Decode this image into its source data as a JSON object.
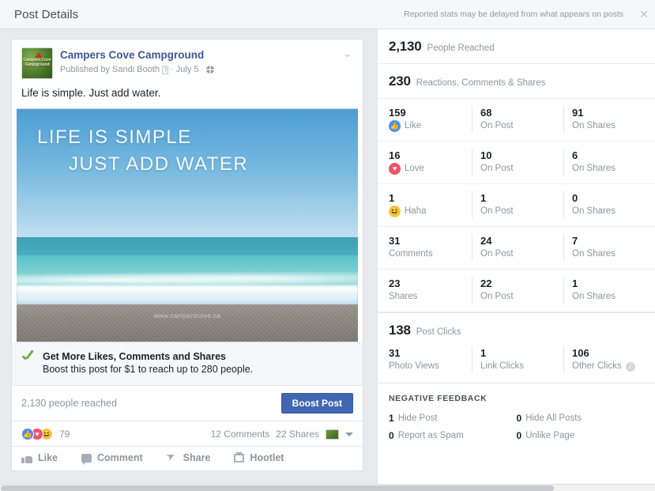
{
  "titlebar": {
    "title": "Post Details",
    "note": "Reported stats may be delayed from what appears on posts",
    "close_icon": "✕"
  },
  "post": {
    "page_name": "Campers Cove Campground",
    "published_prefix": "Published by Sandi Booth",
    "question_mark": "?",
    "separator": "·",
    "date": "July 5",
    "caret": "⌄",
    "message": "Life is simple. Just add water.",
    "photo": {
      "caption_line1": "LIFE IS SIMPLE",
      "caption_line2": "JUST ADD WATER",
      "watermark": "www.camperscove.ca"
    },
    "boost": {
      "title": "Get More Likes, Comments and Shares",
      "subtitle": "Boost this post for $1 to reach up to 280 people.",
      "reach_text": "2,130 people reached",
      "button_label": "Boost Post"
    },
    "engagement": {
      "reaction_count": "79",
      "comments_text": "12 Comments",
      "shares_text": "22 Shares",
      "caret": "▾"
    },
    "actions": [
      {
        "label": "Like",
        "icon": "thumb-icon"
      },
      {
        "label": "Comment",
        "icon": "comment-icon"
      },
      {
        "label": "Share",
        "icon": "share-icon"
      },
      {
        "label": "Hootlet",
        "icon": "hootlet-icon"
      }
    ]
  },
  "stats": {
    "reached": {
      "value": "2,130",
      "label": "People Reached"
    },
    "reactions_summary": {
      "value": "230",
      "label": "Reactions, Comments & Shares"
    },
    "rows": [
      {
        "icon": "like-icon",
        "total": "159",
        "total_label": "Like",
        "on_post": "68",
        "on_post_label": "On Post",
        "on_shares": "91",
        "on_shares_label": "On Shares"
      },
      {
        "icon": "love-icon",
        "total": "16",
        "total_label": "Love",
        "on_post": "10",
        "on_post_label": "On Post",
        "on_shares": "6",
        "on_shares_label": "On Shares"
      },
      {
        "icon": "haha-icon",
        "total": "1",
        "total_label": "Haha",
        "on_post": "1",
        "on_post_label": "On Post",
        "on_shares": "0",
        "on_shares_label": "On Shares"
      },
      {
        "icon": "",
        "total": "31",
        "total_label": "Comments",
        "on_post": "24",
        "on_post_label": "On Post",
        "on_shares": "7",
        "on_shares_label": "On Shares"
      },
      {
        "icon": "",
        "total": "23",
        "total_label": "Shares",
        "on_post": "22",
        "on_post_label": "On Post",
        "on_shares": "1",
        "on_shares_label": "On Shares"
      }
    ],
    "clicks": {
      "value": "138",
      "label": "Post Clicks",
      "photo_views": "31",
      "photo_views_label": "Photo Views",
      "link_clicks": "1",
      "link_clicks_label": "Link Clicks",
      "other_clicks": "106",
      "other_clicks_label": "Other Clicks",
      "info_icon": "i"
    },
    "negative_feedback": {
      "title": "NEGATIVE FEEDBACK",
      "items": [
        {
          "value": "1",
          "label": "Hide Post"
        },
        {
          "value": "0",
          "label": "Hide All Posts"
        },
        {
          "value": "0",
          "label": "Report as Spam"
        },
        {
          "value": "0",
          "label": "Unlike Page"
        }
      ]
    }
  },
  "icons": {
    "like_glyph": "👍",
    "love_glyph": "♥",
    "haha_glyph": "😄"
  }
}
